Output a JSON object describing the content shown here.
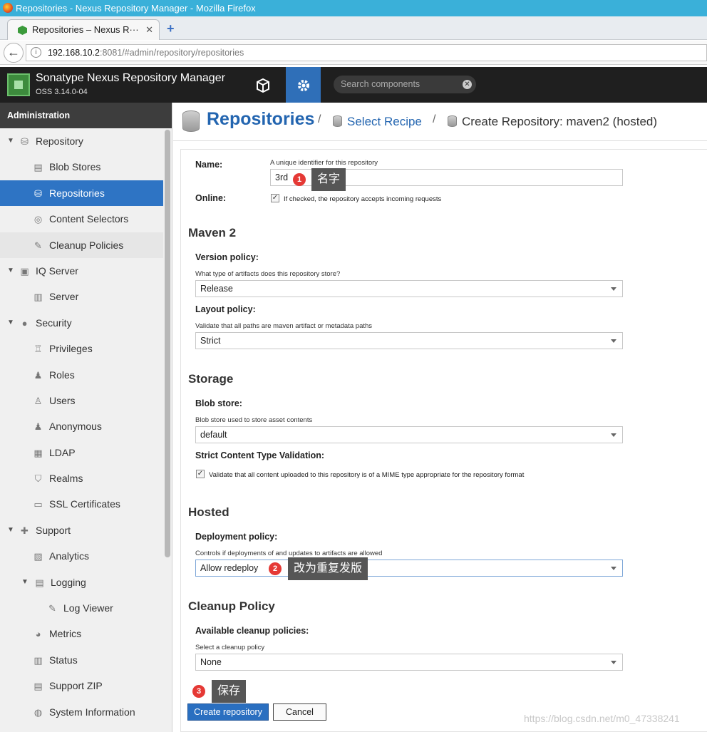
{
  "browser": {
    "window_title": "Repositories - Nexus Repository Manager - Mozilla Firefox",
    "tab_title": "Repositories – Nexus R···",
    "url_host": "192.168.10.2",
    "url_rest": ":8081/#admin/repository/repositories"
  },
  "app": {
    "name": "Sonatype Nexus Repository Manager",
    "version": "OSS 3.14.0-04",
    "search_placeholder": "Search components"
  },
  "sidebar": {
    "header": "Administration",
    "items": [
      {
        "label": "Repository",
        "icon": "database-icon"
      },
      {
        "label": "Blob Stores",
        "icon": "blob-stores-icon"
      },
      {
        "label": "Repositories",
        "icon": "database-icon"
      },
      {
        "label": "Content Selectors",
        "icon": "content-selectors-icon"
      },
      {
        "label": "Cleanup Policies",
        "icon": "broom-icon"
      },
      {
        "label": "IQ Server",
        "icon": "iq-server-icon"
      },
      {
        "label": "Server",
        "icon": "server-icon"
      },
      {
        "label": "Security",
        "icon": "security-icon"
      },
      {
        "label": "Privileges",
        "icon": "privileges-icon"
      },
      {
        "label": "Roles",
        "icon": "roles-icon"
      },
      {
        "label": "Users",
        "icon": "users-icon"
      },
      {
        "label": "Anonymous",
        "icon": "anonymous-icon"
      },
      {
        "label": "LDAP",
        "icon": "ldap-icon"
      },
      {
        "label": "Realms",
        "icon": "realms-icon"
      },
      {
        "label": "SSL Certificates",
        "icon": "ssl-certificates-icon"
      },
      {
        "label": "Support",
        "icon": "support-icon"
      },
      {
        "label": "Analytics",
        "icon": "analytics-icon"
      },
      {
        "label": "Logging",
        "icon": "logging-icon"
      },
      {
        "label": "Log Viewer",
        "icon": "log-viewer-icon"
      },
      {
        "label": "Metrics",
        "icon": "metrics-icon"
      },
      {
        "label": "Status",
        "icon": "status-icon"
      },
      {
        "label": "Support ZIP",
        "icon": "support-zip-icon"
      },
      {
        "label": "System Information",
        "icon": "system-information-icon"
      }
    ]
  },
  "breadcrumb": {
    "root": "Repositories",
    "sep": "/",
    "recipe": "Select Recipe",
    "current": "Create Repository: maven2 (hosted)"
  },
  "form": {
    "name_label": "Name:",
    "name_help": "A unique identifier for this repository",
    "name_value": "3rd",
    "online_label": "Online:",
    "online_help": "If checked, the repository accepts incoming requests",
    "maven_section": "Maven 2",
    "version_label": "Version policy:",
    "version_help": "What type of artifacts does this repository store?",
    "version_value": "Release",
    "layout_label": "Layout policy:",
    "layout_help": "Validate that all paths are maven artifact or metadata paths",
    "layout_value": "Strict",
    "storage_section": "Storage",
    "blob_label": "Blob store:",
    "blob_help": "Blob store used to store asset contents",
    "blob_value": "default",
    "strict_label": "Strict Content Type Validation:",
    "strict_help": "Validate that all content uploaded to this repository is of a MIME type appropriate for the repository format",
    "hosted_section": "Hosted",
    "deploy_label": "Deployment policy:",
    "deploy_help": "Controls if deployments of and updates to artifacts are allowed",
    "deploy_value": "Allow redeploy",
    "cleanup_section": "Cleanup Policy",
    "cleanup_label": "Available cleanup policies:",
    "cleanup_help": "Select a cleanup policy",
    "cleanup_value": "None",
    "create_button": "Create repository",
    "cancel_button": "Cancel"
  },
  "annotations": [
    {
      "num": "1",
      "text": "名字"
    },
    {
      "num": "2",
      "text": "改为重复发版"
    },
    {
      "num": "3",
      "text": "保存"
    }
  ],
  "watermark": "https://blog.csdn.net/m0_47338241",
  "colors": {
    "accent": "#2e74c4",
    "appbar": "#1f1f1f",
    "callout": "#565656",
    "badge": "#e53935"
  }
}
